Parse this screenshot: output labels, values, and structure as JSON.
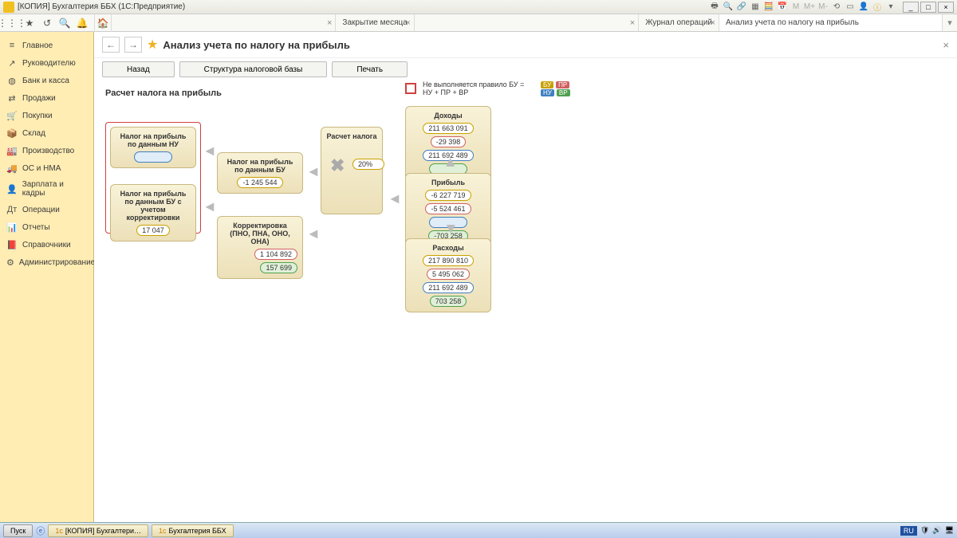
{
  "window": {
    "title": "[КОПИЯ] Бухгалтерия ББХ  (1С:Предприятие)"
  },
  "tabs": [
    {
      "label": "",
      "closable": true
    },
    {
      "label": "Закрытие месяца",
      "closable": true
    },
    {
      "label": "",
      "closable": true
    },
    {
      "label": "Журнал операций",
      "closable": true
    },
    {
      "label": "Анализ учета по налогу на прибыль",
      "closable": false,
      "active": true
    }
  ],
  "sidebar": {
    "items": [
      {
        "icon": "≡",
        "label": "Главное"
      },
      {
        "icon": "↗",
        "label": "Руководителю"
      },
      {
        "icon": "◍",
        "label": "Банк и касса"
      },
      {
        "icon": "⇄",
        "label": "Продажи"
      },
      {
        "icon": "🛒",
        "label": "Покупки"
      },
      {
        "icon": "📦",
        "label": "Склад"
      },
      {
        "icon": "🏭",
        "label": "Производство"
      },
      {
        "icon": "🚚",
        "label": "ОС и НМА"
      },
      {
        "icon": "👤",
        "label": "Зарплата и кадры"
      },
      {
        "icon": "Дт",
        "label": "Операции"
      },
      {
        "icon": "📊",
        "label": "Отчеты"
      },
      {
        "icon": "📕",
        "label": "Справочники"
      },
      {
        "icon": "⚙",
        "label": "Администрирование"
      }
    ]
  },
  "page": {
    "title": "Анализ учета по налогу на прибыль",
    "toolbar": {
      "back": "Назад",
      "structure": "Структура налоговой базы",
      "print": "Печать"
    },
    "subtitle": "Расчет налога на прибыль",
    "legend": {
      "rule": "Не выполняется правило БУ = НУ + ПР + ВР",
      "bu": "БУ",
      "nu": "НУ",
      "pr": "ПР",
      "vr": "ВР"
    },
    "nodes": {
      "tax_nu": {
        "title": "Налог на прибыль по данным НУ"
      },
      "tax_bu": {
        "title": "Налог на прибыль по данным БУ",
        "val": "-1 245 544"
      },
      "tax_bu_corr": {
        "title": "Налог на прибыль по данным БУ с учетом корректировки",
        "val": "17 047"
      },
      "corr": {
        "title": "Корректировка (ПНО, ПНА, ОНО, ОНА)",
        "v1": "1 104 892",
        "v2": "157 699"
      },
      "calc": {
        "title": "Расчет налога",
        "pct": "20%"
      },
      "income": {
        "title": "Доходы",
        "bu": "211 663 091",
        "pr": "-29 398",
        "nu": "211 692 489"
      },
      "profit": {
        "title": "Прибыль",
        "bu": "-6 227 719",
        "pr": "-5 524 461",
        "vr": "-703 258"
      },
      "expense": {
        "title": "Расходы",
        "bu": "217 890 810",
        "pr": "5 495 062",
        "nu": "211 692 489",
        "vr": "703 258"
      }
    }
  },
  "taskbar": {
    "start": "Пуск",
    "items": [
      "[КОПИЯ] Бухгалтери…",
      "Бухгалтерия ББХ"
    ],
    "lang": "RU"
  }
}
